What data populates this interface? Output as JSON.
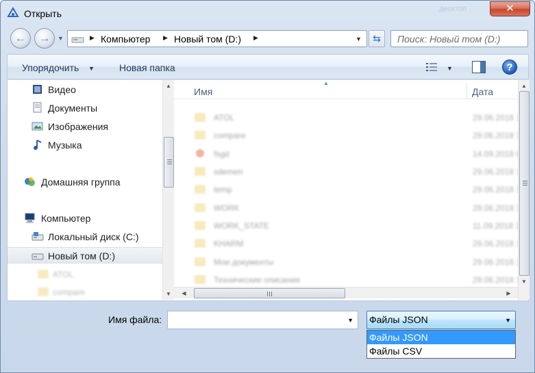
{
  "window": {
    "title": "Открыть",
    "close_label": "✕",
    "ghost_title": "десктоп"
  },
  "address": {
    "crumbs": [
      "Компьютер",
      "Новый том (D:)"
    ],
    "search_placeholder": "Поиск: Новый том (D:)"
  },
  "toolbar": {
    "organize_label": "Упорядочить",
    "new_folder_label": "Новая папка",
    "help_label": "?"
  },
  "nav": {
    "items": [
      {
        "label": "Видео",
        "icon": "video-library-icon"
      },
      {
        "label": "Документы",
        "icon": "documents-library-icon"
      },
      {
        "label": "Изображения",
        "icon": "pictures-library-icon"
      },
      {
        "label": "Музыка",
        "icon": "music-library-icon"
      },
      {
        "label": "Домашняя группа",
        "icon": "homegroup-icon"
      },
      {
        "label": "Компьютер",
        "icon": "computer-icon"
      },
      {
        "label": "Локальный диск (C:)",
        "icon": "drive-icon"
      },
      {
        "label": "Новый том (D:)",
        "icon": "drive-icon",
        "selected": true
      }
    ],
    "sub_items": [
      "ATOL",
      "compare"
    ]
  },
  "files": {
    "columns": {
      "name": "Имя",
      "date": "Дата"
    },
    "rows": [
      {
        "name": "ATOL",
        "date": "29.06.2018 1"
      },
      {
        "name": "compare",
        "date": "29.06.2018 1"
      },
      {
        "name": "fsgd",
        "date": "14.09.2018 8"
      },
      {
        "name": "sdemen",
        "date": "29.06.2018 1"
      },
      {
        "name": "temp",
        "date": "29.06.2018 1"
      },
      {
        "name": "WORK",
        "date": "29.06.2018 1"
      },
      {
        "name": "WORK_STATE",
        "date": "11.09.2018 1"
      },
      {
        "name": "KHARM",
        "date": "29.06.2018 1"
      },
      {
        "name": "Мои документы",
        "date": "29.06.2018 1"
      },
      {
        "name": "Технические описания",
        "date": "29.06.2018 1"
      }
    ]
  },
  "bottom": {
    "filename_label": "Имя файла:",
    "filename_value": "",
    "filetype_selected": "Файлы JSON",
    "filetype_options": [
      "Файлы JSON",
      "Файлы CSV"
    ]
  },
  "colors": {
    "selection": "#3399ff",
    "close_button": "#c8452c",
    "toolbar_text": "#1e395b"
  }
}
